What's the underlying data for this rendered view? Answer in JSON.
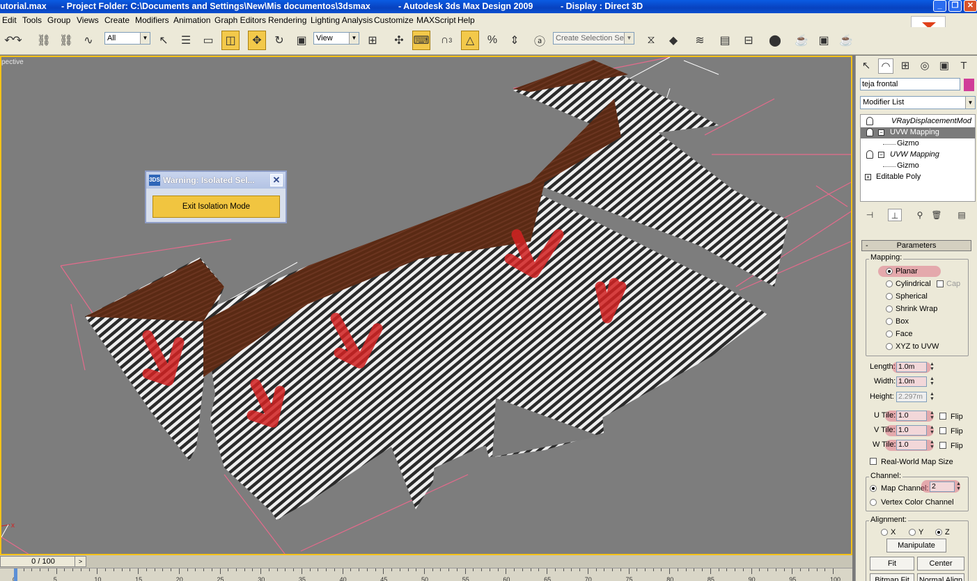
{
  "titlebar": {
    "file": "utorial.max",
    "project": "- Project Folder: C:\\Documents and Settings\\New\\Mis documentos\\3dsmax",
    "app": "- Autodesk 3ds Max Design 2009",
    "display": "- Display : Direct 3D",
    "min_icon": "_",
    "max_icon": "❐",
    "close_icon": "✕"
  },
  "menu": [
    "Edit",
    "Tools",
    "Group",
    "Views",
    "Create",
    "Modifiers",
    "Animation",
    "Graph Editors",
    "Rendering",
    "Lighting Analysis",
    "Customize",
    "MAXScript",
    "Help"
  ],
  "toolbar": {
    "filter_value": "All",
    "refcoord_value": "View",
    "selection_set_placeholder": "Create Selection Set",
    "snap_label": "3",
    "icons": {
      "undo": "↶",
      "redo": "↷",
      "link": "⛓",
      "unlink": "⛓",
      "bind": "∿",
      "select": "↖",
      "select_by_name": "☰",
      "rect_region": "▭",
      "window_crossing": "◫",
      "move": "✥",
      "rotate": "↻",
      "scale": "▣",
      "pivot": "⊞",
      "manipulate": "✣",
      "keyboard": "⌨",
      "snaps": "∩",
      "angle_snap": "△",
      "percent_snap": "%",
      "spinner_snap": "⇕",
      "named_sel": "ⓐ",
      "mirror": "⧖",
      "align": "◆",
      "layers": "≋",
      "curve_editor": "▤",
      "schematic": "⊟",
      "material": "⬤",
      "render_setup": "☕",
      "render_frame": "▣",
      "quick_render": "☕"
    }
  },
  "viewport": {
    "label": "pective"
  },
  "warning": {
    "icon": "3DS",
    "title": "Warning: Isolated Sel...",
    "close": "✕",
    "button": "Exit Isolation Mode"
  },
  "command_panel": {
    "tab_icons": {
      "create": "↖",
      "modify": "◠",
      "hierarchy": "⊞",
      "motion": "◎",
      "display": "▣",
      "utilities": "T"
    },
    "object_name": "teja frontal",
    "object_color": "#d03d98",
    "modifier_list": "Modifier List",
    "stack": {
      "vray": "VRayDisplacementMod",
      "uvw1": "UVW Mapping",
      "gizmo1": "Gizmo",
      "uvw2": "UVW Mapping",
      "gizmo2": "Gizmo",
      "epoly": "Editable Poly",
      "minus": "−",
      "plus": "+"
    },
    "stack_buttons": {
      "pin": "⊣",
      "show_end": "⊥",
      "unique": "⚲",
      "remove": "🗑",
      "configure": "▤"
    },
    "parameters": {
      "rollout": "Parameters",
      "rollout_toggle": "-",
      "mapping_label": "Mapping:",
      "mapping": [
        "Planar",
        "Cylindrical",
        "Spherical",
        "Shrink Wrap",
        "Box",
        "Face",
        "XYZ to UVW"
      ],
      "cap_label": "Cap",
      "length_label": "Length:",
      "length": "1.0m",
      "width_label": "Width:",
      "width": "1.0m",
      "height_label": "Height:",
      "height": "2.297m",
      "utile_label": "U Tile:",
      "utile": "1.0",
      "vtile_label": "V Tile:",
      "vtile": "1.0",
      "wtile_label": "W Tile:",
      "wtile": "1.0",
      "flip_label": "Flip",
      "realworld_label": "Real-World Map Size",
      "channel_label": "Channel:",
      "map_channel_label": "Map Channel:",
      "map_channel": "2",
      "vertex_color_label": "Vertex Color Channel",
      "alignment_label": "Alignment:",
      "x_label": "X",
      "y_label": "Y",
      "z_label": "Z",
      "manipulate_label": "Manipulate",
      "fit_label": "Fit",
      "center_label": "Center",
      "bitmap_fit_label": "Bitmap Fit",
      "normal_align_label": "Normal Align",
      "spin_up": "▲",
      "spin_down": "▼"
    }
  },
  "timeline": {
    "frame": "0 / 100",
    "arrow": ">",
    "ticks": [
      "0",
      "5",
      "10",
      "15",
      "20",
      "25",
      "30",
      "35",
      "40",
      "45",
      "50",
      "55",
      "60",
      "65",
      "70",
      "75",
      "80",
      "85",
      "90",
      "95",
      "100"
    ]
  },
  "colors": {
    "viewport_border": "#f5c218",
    "selection_highlight": "#7b7b7b",
    "annotation_red": "#d22222",
    "roof_brown": "#5a2a14"
  }
}
